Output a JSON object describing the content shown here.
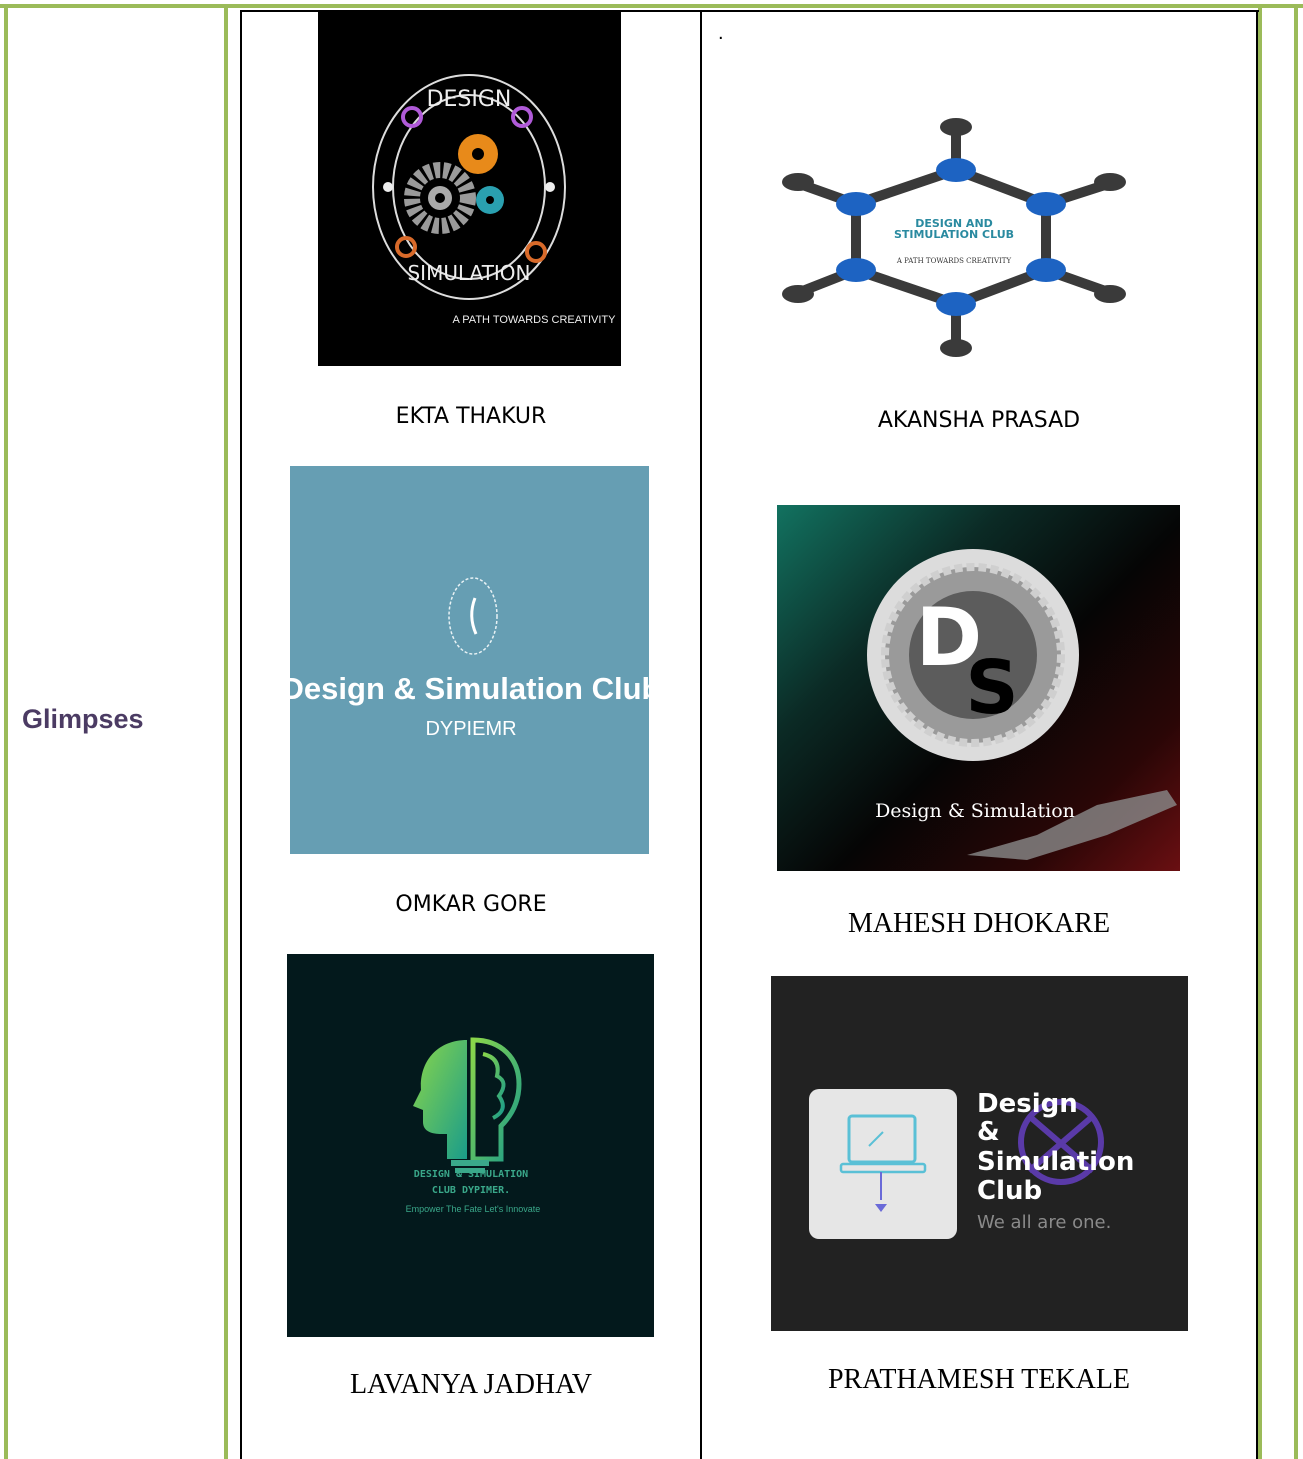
{
  "section_label": "Glimpses",
  "stray_mark": ".",
  "entries": [
    {
      "name": "EKTA THAKUR",
      "logo_lines": [
        "DESIGN",
        "SIMULATION",
        "A PATH TOWARDS CREATIVITY"
      ]
    },
    {
      "name": "AKANSHA PRASAD",
      "logo_lines": [
        "DESIGN AND",
        "STIMULATION CLUB",
        "A PATH TOWARDS CREATIVITY"
      ]
    },
    {
      "name": "OMKAR GORE",
      "logo_lines": [
        "Design & Simulation Club",
        "DYPIEMR"
      ]
    },
    {
      "name": "MAHESH DHOKARE",
      "logo_lines": [
        "D",
        "S",
        "Design & Simulation"
      ]
    },
    {
      "name": "LAVANYA JADHAV",
      "logo_lines": [
        "DESIGN & SIMULATION",
        "CLUB DYPIMER.",
        "Empower The Fate Let's Innovate"
      ]
    },
    {
      "name": "PRATHAMESH TEKALE",
      "logo_lines": [
        "Design",
        "&",
        "Simulation",
        "Club",
        "We all are one."
      ]
    }
  ]
}
